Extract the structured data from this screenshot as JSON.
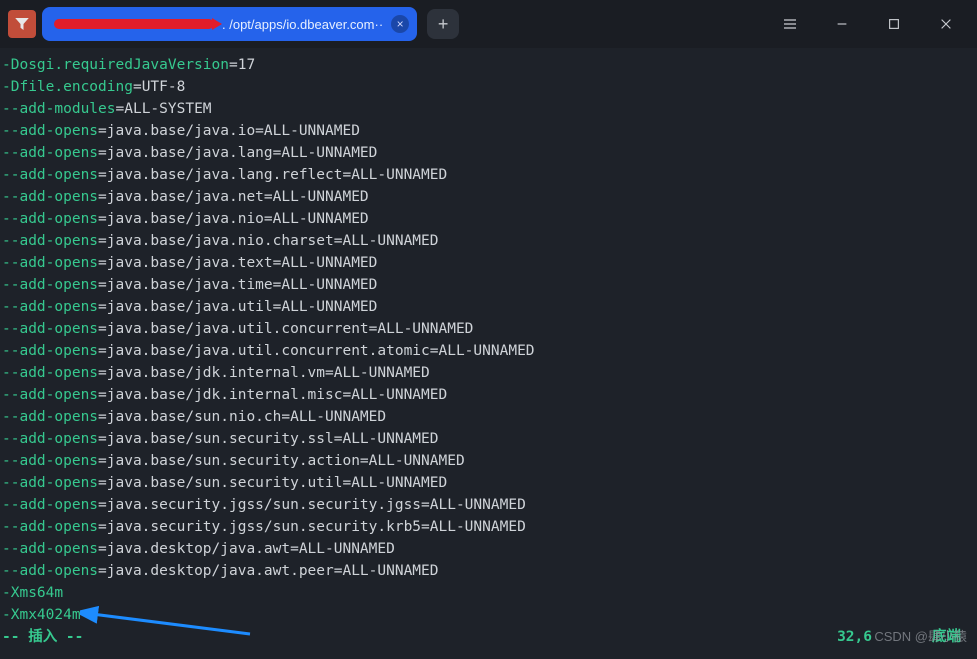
{
  "titlebar": {
    "tab_text": ". /opt/apps/io.dbeaver.com··",
    "tab_close": "×",
    "new_tab": "+"
  },
  "terminal": {
    "kv": [
      {
        "k": "-Dosgi.requiredJavaVersion",
        "v": "17"
      },
      {
        "k": "-Dfile.encoding",
        "v": "UTF-8"
      },
      {
        "k": "--add-modules",
        "v": "ALL-SYSTEM"
      },
      {
        "k": "--add-opens",
        "v": "java.base/java.io=ALL-UNNAMED"
      },
      {
        "k": "--add-opens",
        "v": "java.base/java.lang=ALL-UNNAMED"
      },
      {
        "k": "--add-opens",
        "v": "java.base/java.lang.reflect=ALL-UNNAMED"
      },
      {
        "k": "--add-opens",
        "v": "java.base/java.net=ALL-UNNAMED"
      },
      {
        "k": "--add-opens",
        "v": "java.base/java.nio=ALL-UNNAMED"
      },
      {
        "k": "--add-opens",
        "v": "java.base/java.nio.charset=ALL-UNNAMED"
      },
      {
        "k": "--add-opens",
        "v": "java.base/java.text=ALL-UNNAMED"
      },
      {
        "k": "--add-opens",
        "v": "java.base/java.time=ALL-UNNAMED"
      },
      {
        "k": "--add-opens",
        "v": "java.base/java.util=ALL-UNNAMED"
      },
      {
        "k": "--add-opens",
        "v": "java.base/java.util.concurrent=ALL-UNNAMED"
      },
      {
        "k": "--add-opens",
        "v": "java.base/java.util.concurrent.atomic=ALL-UNNAMED"
      },
      {
        "k": "--add-opens",
        "v": "java.base/jdk.internal.vm=ALL-UNNAMED"
      },
      {
        "k": "--add-opens",
        "v": "java.base/jdk.internal.misc=ALL-UNNAMED"
      },
      {
        "k": "--add-opens",
        "v": "java.base/sun.nio.ch=ALL-UNNAMED"
      },
      {
        "k": "--add-opens",
        "v": "java.base/sun.security.ssl=ALL-UNNAMED"
      },
      {
        "k": "--add-opens",
        "v": "java.base/sun.security.action=ALL-UNNAMED"
      },
      {
        "k": "--add-opens",
        "v": "java.base/sun.security.util=ALL-UNNAMED"
      },
      {
        "k": "--add-opens",
        "v": "java.security.jgss/sun.security.jgss=ALL-UNNAMED"
      },
      {
        "k": "--add-opens",
        "v": "java.security.jgss/sun.security.krb5=ALL-UNNAMED"
      },
      {
        "k": "--add-opens",
        "v": "java.desktop/java.awt=ALL-UNNAMED"
      },
      {
        "k": "--add-opens",
        "v": "java.desktop/java.awt.peer=ALL-UNNAMED"
      }
    ],
    "plain": [
      "-Xms64m",
      "-Xmx4024m"
    ],
    "mode": "-- 插入 --",
    "pos": "32,6",
    "end": "底端"
  },
  "watermark": "CSDN @肆小猿"
}
